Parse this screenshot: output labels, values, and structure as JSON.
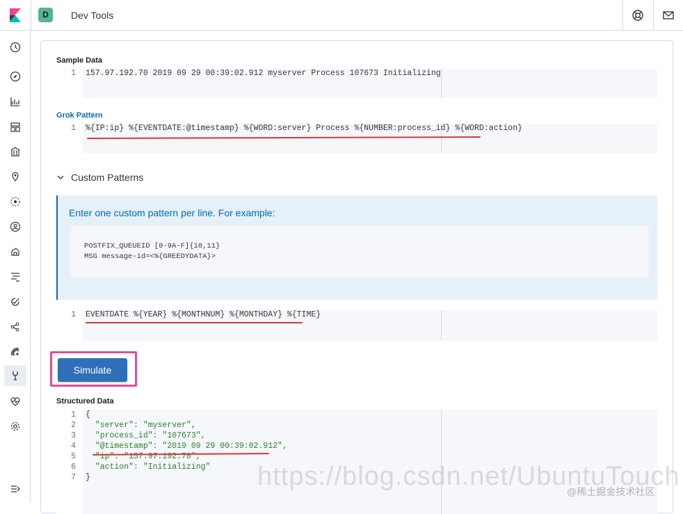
{
  "header": {
    "space_initial": "D",
    "app_title": "Dev Tools"
  },
  "sample_data": {
    "label": "Sample Data",
    "lines": [
      {
        "n": "1",
        "text": "157.97.192.70 2019 09 29 00:39:02.912 myserver Process 107673 Initializing"
      }
    ]
  },
  "grok_pattern": {
    "label": "Grok Pattern",
    "lines": [
      {
        "n": "1",
        "text": "%{IP:ip} %{EVENTDATE:@timestamp} %{WORD:server} Process %{NUMBER:process_id} %{WORD:action}"
      }
    ]
  },
  "custom_patterns": {
    "toggle_label": "Custom Patterns",
    "help_title": "Enter one custom pattern per line. For example:",
    "example_lines": [
      "POSTFIX_QUEUEID [0-9A-F]{10,11}",
      "MSG message-id=<%{GREEDYDATA}>"
    ],
    "editor_lines": [
      {
        "n": "1",
        "text": "EVENTDATE %{YEAR} %{MONTHNUM} %{MONTHDAY} %{TIME}"
      }
    ]
  },
  "simulate_label": "Simulate",
  "structured_data": {
    "label": "Structured Data",
    "lines": [
      {
        "n": "1",
        "text": "{"
      },
      {
        "n": "2",
        "text": "  \"server\": \"myserver\","
      },
      {
        "n": "3",
        "text": "  \"process_id\": \"107673\","
      },
      {
        "n": "4",
        "text": "  \"@timestamp\": \"2019 09 29 00:39:02.912\","
      },
      {
        "n": "5",
        "text": "  \"ip\": \"157.97.192.70\","
      },
      {
        "n": "6",
        "text": "  \"action\": \"Initializing\""
      },
      {
        "n": "7",
        "text": "}"
      }
    ]
  },
  "watermark": {
    "url": "https://blog.csdn.net/UbuntuTouch",
    "credit": "@稀土掘金技术社区"
  },
  "icons": {
    "logo": "kibana-logo-icon",
    "help": "help-lifebuoy-icon",
    "mail": "mail-icon",
    "nav": [
      "clock-icon",
      "compass-icon",
      "visualize-icon",
      "dashboard-icon",
      "canvas-icon",
      "maps-icon",
      "ml-icon",
      "infrastructure-icon",
      "logs-icon",
      "apm-icon",
      "uptime-icon",
      "graph-icon",
      "siem-icon",
      "dev-tools-icon",
      "monitoring-icon",
      "settings-icon",
      "collapse-icon"
    ]
  },
  "colors": {
    "accent": "#006bb4",
    "button": "#2f6fb7",
    "highlight_border": "#e24d91",
    "annotation_underline": "#d6373a",
    "space_badge": "#54b399"
  }
}
